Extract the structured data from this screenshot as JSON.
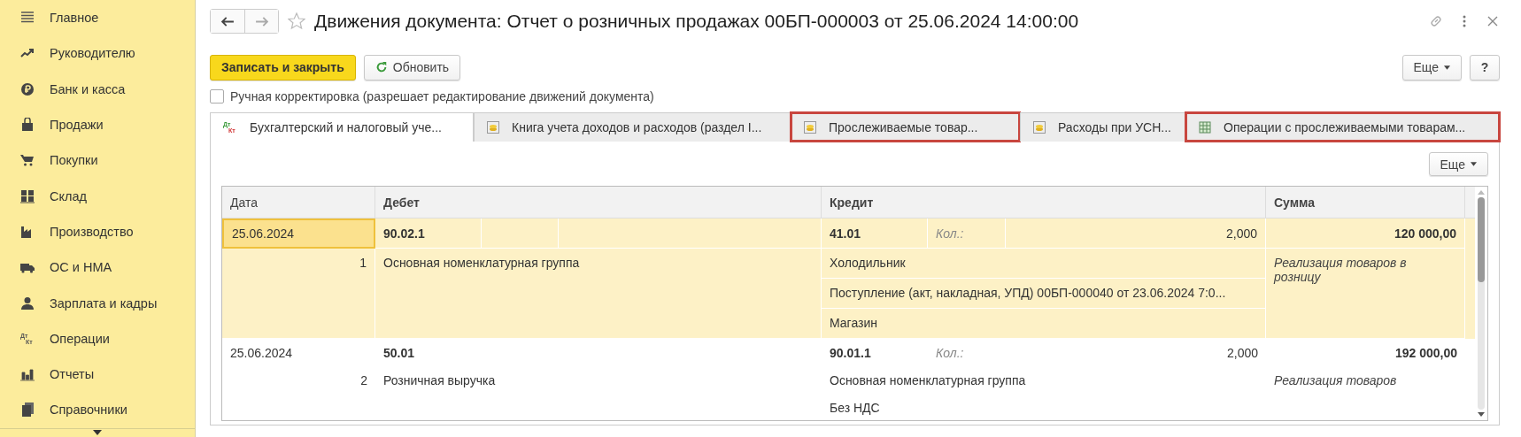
{
  "sidebar": {
    "items": [
      {
        "label": "Главное",
        "kind": "lines"
      },
      {
        "label": "Руководителю",
        "kind": "trend"
      },
      {
        "label": "Банк и касса",
        "kind": "ruble"
      },
      {
        "label": "Продажи",
        "kind": "bag"
      },
      {
        "label": "Покупки",
        "kind": "cart"
      },
      {
        "label": "Склад",
        "kind": "blocks"
      },
      {
        "label": "Производство",
        "kind": "factory"
      },
      {
        "label": "ОС и НМА",
        "kind": "truck"
      },
      {
        "label": "Зарплата и кадры",
        "kind": "person"
      },
      {
        "label": "Операции",
        "kind": "dtkt",
        "icon_text": [
          "Дт",
          "Кт"
        ]
      },
      {
        "label": "Отчеты",
        "kind": "bars"
      },
      {
        "label": "Справочники",
        "kind": "books"
      }
    ]
  },
  "window": {
    "title": "Движения документа: Отчет о розничных продажах 00БП-000003 от 25.06.2024 14:00:00"
  },
  "toolbar": {
    "save_button": "Записать и закрыть",
    "refresh_button": "Обновить",
    "more_button": "Еще",
    "help_button": "?"
  },
  "manual_edit": {
    "label": "Ручная корректировка (разрешает редактирование движений документа)",
    "checked": false
  },
  "tabs": [
    {
      "label": "Бухгалтерский и налоговый уче...",
      "kind": "dtkt",
      "icon_text": [
        "Дт",
        "Кт"
      ],
      "selected": true,
      "highlighted": false
    },
    {
      "label": "Книга учета доходов и расходов (раздел I...",
      "kind": "coins",
      "selected": false,
      "highlighted": false
    },
    {
      "label": "Прослеживаемые товар...",
      "kind": "coins",
      "selected": false,
      "highlighted": true
    },
    {
      "label": "Расходы при УСН...",
      "kind": "coins",
      "selected": false,
      "highlighted": false
    },
    {
      "label": "Операции с прослеживаемыми товарам...",
      "kind": "grid",
      "selected": false,
      "highlighted": true
    }
  ],
  "table": {
    "more_button": "Еще",
    "columns": [
      "Дата",
      "Дебет",
      "Кредит",
      "Сумма"
    ],
    "rows": [
      {
        "selected": true,
        "date": "25.06.2024",
        "number": "1",
        "debit_account": "90.02.1",
        "debit_lines": [
          "Основная номенклатурная группа"
        ],
        "credit_account": "41.01",
        "credit_qty_label": "Кол.:",
        "credit_qty": "2,000",
        "credit_lines": [
          "Холодильник",
          "Поступление (акт, накладная, УПД) 00БП-000040 от 23.06.2024 7:0...",
          "Магазин"
        ],
        "amount": "120 000,00",
        "content": "Реализация товаров в розницу"
      },
      {
        "selected": false,
        "date": "25.06.2024",
        "number": "2",
        "debit_account": "50.01",
        "debit_lines": [
          "Розничная выручка"
        ],
        "credit_account": "90.01.1",
        "credit_qty_label": "Кол.:",
        "credit_qty": "2,000",
        "credit_lines": [
          "Основная номенклатурная группа",
          "Без НДС"
        ],
        "amount": "192 000,00",
        "content": "Реализация товаров"
      }
    ]
  }
}
